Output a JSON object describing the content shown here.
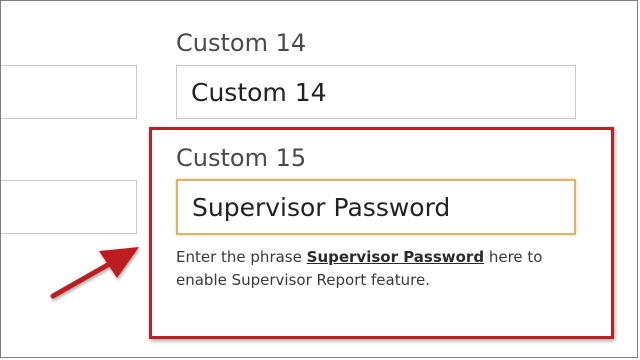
{
  "fields": {
    "custom14": {
      "label": "Custom 14",
      "value": "Custom 14"
    },
    "custom15": {
      "label": "Custom 15",
      "value": "Supervisor Password"
    },
    "left_top_value": "",
    "left_bottom_value": ""
  },
  "help": {
    "prefix": "Enter the phrase",
    "emphasis": "Supervisor Password",
    "suffix": "here to enable Supervisor Report feature."
  },
  "annotation": {
    "color": "#bf1f24"
  },
  "colors": {
    "focus_border": "#e5b16a",
    "input_border": "#c9c9c9"
  }
}
